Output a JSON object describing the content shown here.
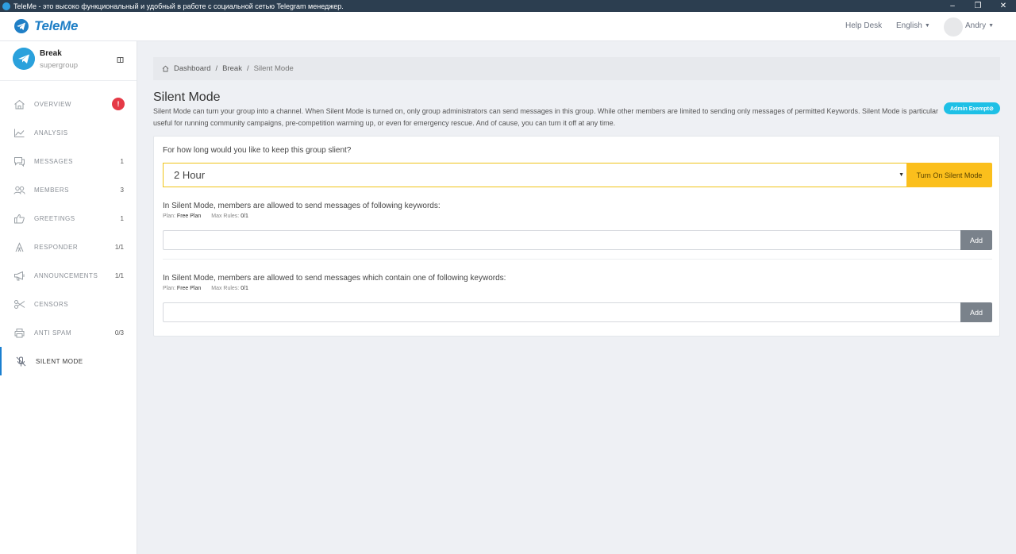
{
  "window": {
    "title": "TeleMe - это высоко функциональный и удобный в работе с социальной сетью Telegram менеджер.",
    "controls": [
      "–",
      "❐",
      "✕"
    ]
  },
  "topnav": {
    "brand": "TeleMe",
    "help_desk": "Help Desk",
    "language": "English",
    "user": "Andry"
  },
  "group": {
    "name": "Break",
    "type": "supergroup"
  },
  "sidebar": {
    "items": [
      {
        "label": "OVERVIEW",
        "count": "",
        "icon": "home-icon",
        "badge": "!"
      },
      {
        "label": "ANALYSIS",
        "count": "",
        "icon": "chart-icon"
      },
      {
        "label": "MESSAGES",
        "count": "1",
        "icon": "message-icon"
      },
      {
        "label": "MEMBERS",
        "count": "3",
        "icon": "users-icon"
      },
      {
        "label": "GREETINGS",
        "count": "1",
        "icon": "thumbs-up-icon"
      },
      {
        "label": "RESPONDER",
        "count": "1/1",
        "icon": "responder-icon"
      },
      {
        "label": "ANNOUNCEMENTS",
        "count": "1/1",
        "icon": "megaphone-icon"
      },
      {
        "label": "CENSORS",
        "count": "",
        "icon": "scissors-icon"
      },
      {
        "label": "ANTI SPAM",
        "count": "0/3",
        "icon": "printer-icon"
      },
      {
        "label": "SILENT MODE",
        "count": "",
        "icon": "mute-icon",
        "active": true
      }
    ]
  },
  "breadcrumb": {
    "home": "Dashboard",
    "group": "Break",
    "current": "Silent Mode",
    "separator": "/"
  },
  "page": {
    "title": "Silent Mode",
    "description": "Silent Mode can turn your group into a channel. When Silent Mode is turned on, only group administrators can send messages in this group. While other members are limited to sending only messages of permitted Keywords. Silent Mode is particular useful for running community campaigns, pre-competition warming up, or even for emergency rescue. And of cause, you can turn it off at any time.",
    "exempt_button": "Admin Exempt⊘"
  },
  "silent": {
    "question": "For how long would you like to keep this group slient?",
    "duration": "2 Hour",
    "turn_on_button": "Turn On Silent Mode"
  },
  "keywords_exact": {
    "label": "In Silent Mode, members are allowed to send messages of following keywords:",
    "plan_label": "Plan:",
    "plan_value": "Free Plan",
    "max_label": "Max Rules:",
    "max_value": "0/1",
    "input_value": "",
    "add_button": "Add"
  },
  "keywords_contain": {
    "label": "In Silent Mode, members are allowed to send messages which contain one of following keywords:",
    "plan_label": "Plan:",
    "plan_value": "Free Plan",
    "max_label": "Max Rules:",
    "max_value": "0/1",
    "input_value": "",
    "add_button": "Add"
  },
  "colors": {
    "brand": "#1f7fc6",
    "warning": "#fbbf1c",
    "alert": "#e53946",
    "info": "#1ec0e6",
    "active_indicator": "#1a7fd0"
  }
}
